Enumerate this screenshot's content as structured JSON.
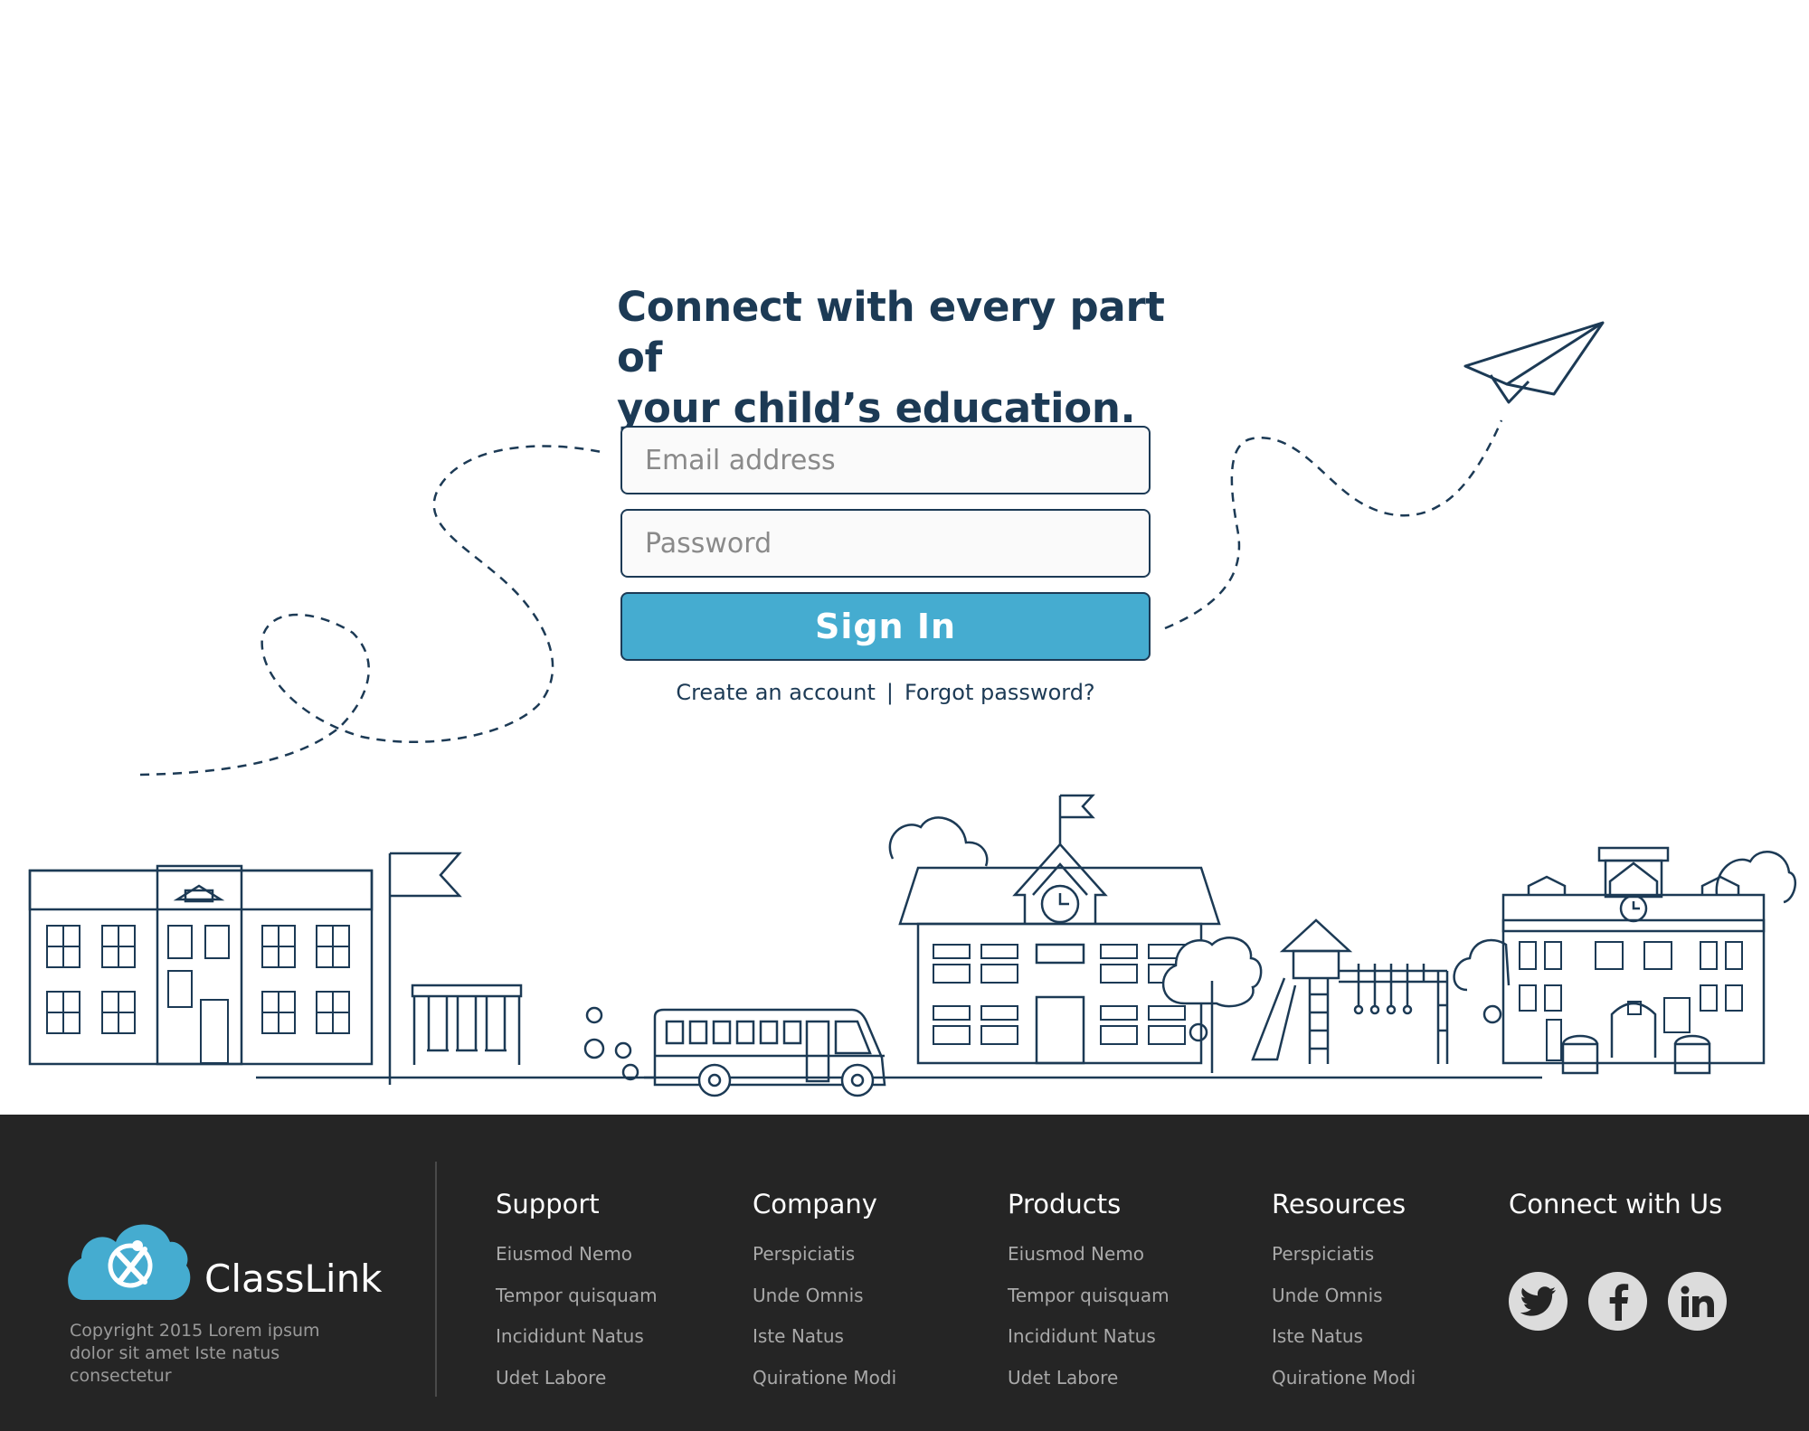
{
  "headline": {
    "line1": "Connect with every part of",
    "line2": "your child’s education."
  },
  "login": {
    "email_placeholder": "Email address",
    "password_placeholder": "Password",
    "signin_label": "Sign In",
    "create_account": "Create an account",
    "separator": "|",
    "forgot_password": "Forgot password?"
  },
  "colors": {
    "navy": "#1c3a55",
    "accent": "#45acd0",
    "footer_bg": "#252525",
    "footer_text": "#a9a9a9"
  },
  "footer": {
    "brand": "ClassLink",
    "copyright": "Copyright 2015 Lorem ipsum dolor sit amet Iste natus consectetur",
    "columns": [
      {
        "title": "Support",
        "items": [
          "Eiusmod Nemo",
          "Tempor quisquam",
          "Incididunt Natus",
          "Udet Labore"
        ]
      },
      {
        "title": "Company",
        "items": [
          "Perspiciatis",
          "Unde Omnis",
          "Iste Natus",
          "Quiratione Modi"
        ]
      },
      {
        "title": "Products",
        "items": [
          "Eiusmod Nemo",
          "Tempor quisquam",
          "Incididunt Natus",
          "Udet Labore"
        ]
      },
      {
        "title": "Resources",
        "items": [
          "Perspiciatis",
          "Unde Omnis",
          "Iste Natus",
          "Quiratione Modi"
        ]
      }
    ],
    "connect_title": "Connect with Us",
    "social": [
      "twitter-icon",
      "facebook-icon",
      "linkedin-icon"
    ]
  }
}
